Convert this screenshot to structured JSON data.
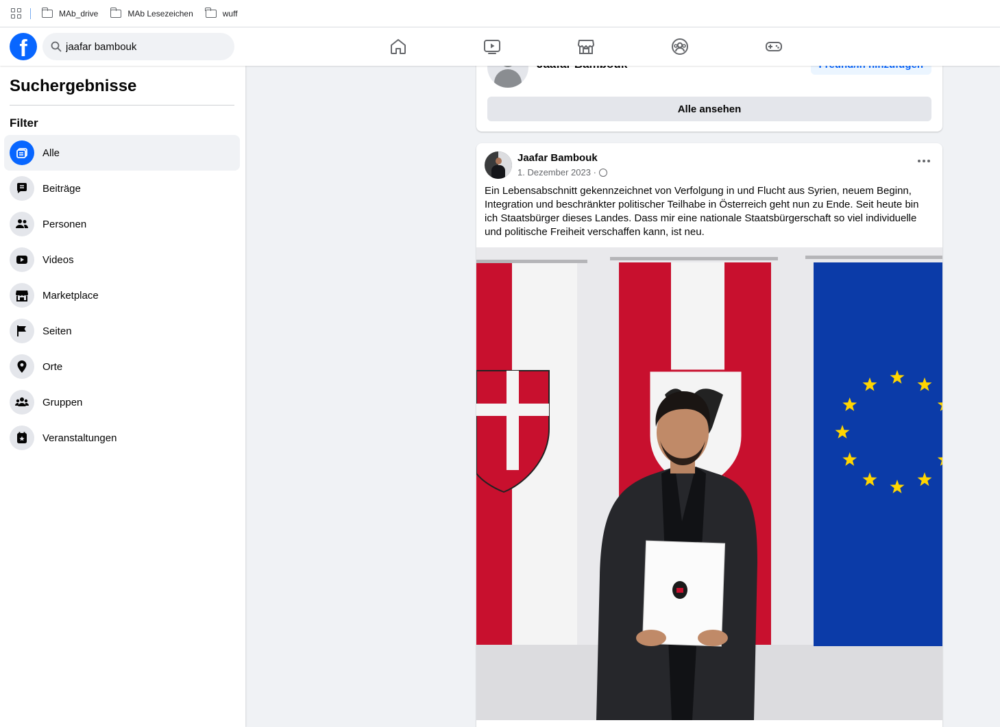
{
  "bookmarks": {
    "items": [
      {
        "label": "MAb_drive"
      },
      {
        "label": "MAb Lesezeichen"
      },
      {
        "label": "wuff"
      }
    ]
  },
  "topnav": {
    "search_value": "jaafar bambouk",
    "logo": "f"
  },
  "sidebar": {
    "title": "Suchergebnisse",
    "filter_label": "Filter",
    "items": [
      {
        "label": "Alle",
        "icon": "all-results-icon",
        "active": true
      },
      {
        "label": "Beiträge",
        "icon": "posts-icon"
      },
      {
        "label": "Personen",
        "icon": "people-icon"
      },
      {
        "label": "Videos",
        "icon": "video-icon"
      },
      {
        "label": "Marketplace",
        "icon": "marketplace-icon"
      },
      {
        "label": "Seiten",
        "icon": "flag-icon"
      },
      {
        "label": "Orte",
        "icon": "location-pin-icon"
      },
      {
        "label": "Gruppen",
        "icon": "groups-icon"
      },
      {
        "label": "Veranstaltungen",
        "icon": "calendar-star-icon"
      }
    ]
  },
  "people_card": {
    "name": "Jaafar Bambouk",
    "add_friend_label": "Freund/in hinzufügen",
    "see_all_label": "Alle ansehen"
  },
  "post": {
    "author": "Jaafar Bambouk",
    "date": "1. Dezember 2023 ·",
    "text": "Ein Lebensabschnitt gekennzeichnet von Verfolgung in und Flucht aus Syrien, neuem Beginn, Integration und beschränkter politischer Teilhabe in Österreich geht nun zu Ende. Seit heute bin ich Staatsbürger dieses Landes. Dass mir eine nationale Staatsbürgerschaft so viel individuelle und politische Freiheit verschaffen kann, ist neu."
  },
  "colors": {
    "brand": "#0866ff",
    "austria_red": "#c8102e",
    "eu_blue": "#0b3ba8",
    "eu_star": "#ffd500"
  }
}
